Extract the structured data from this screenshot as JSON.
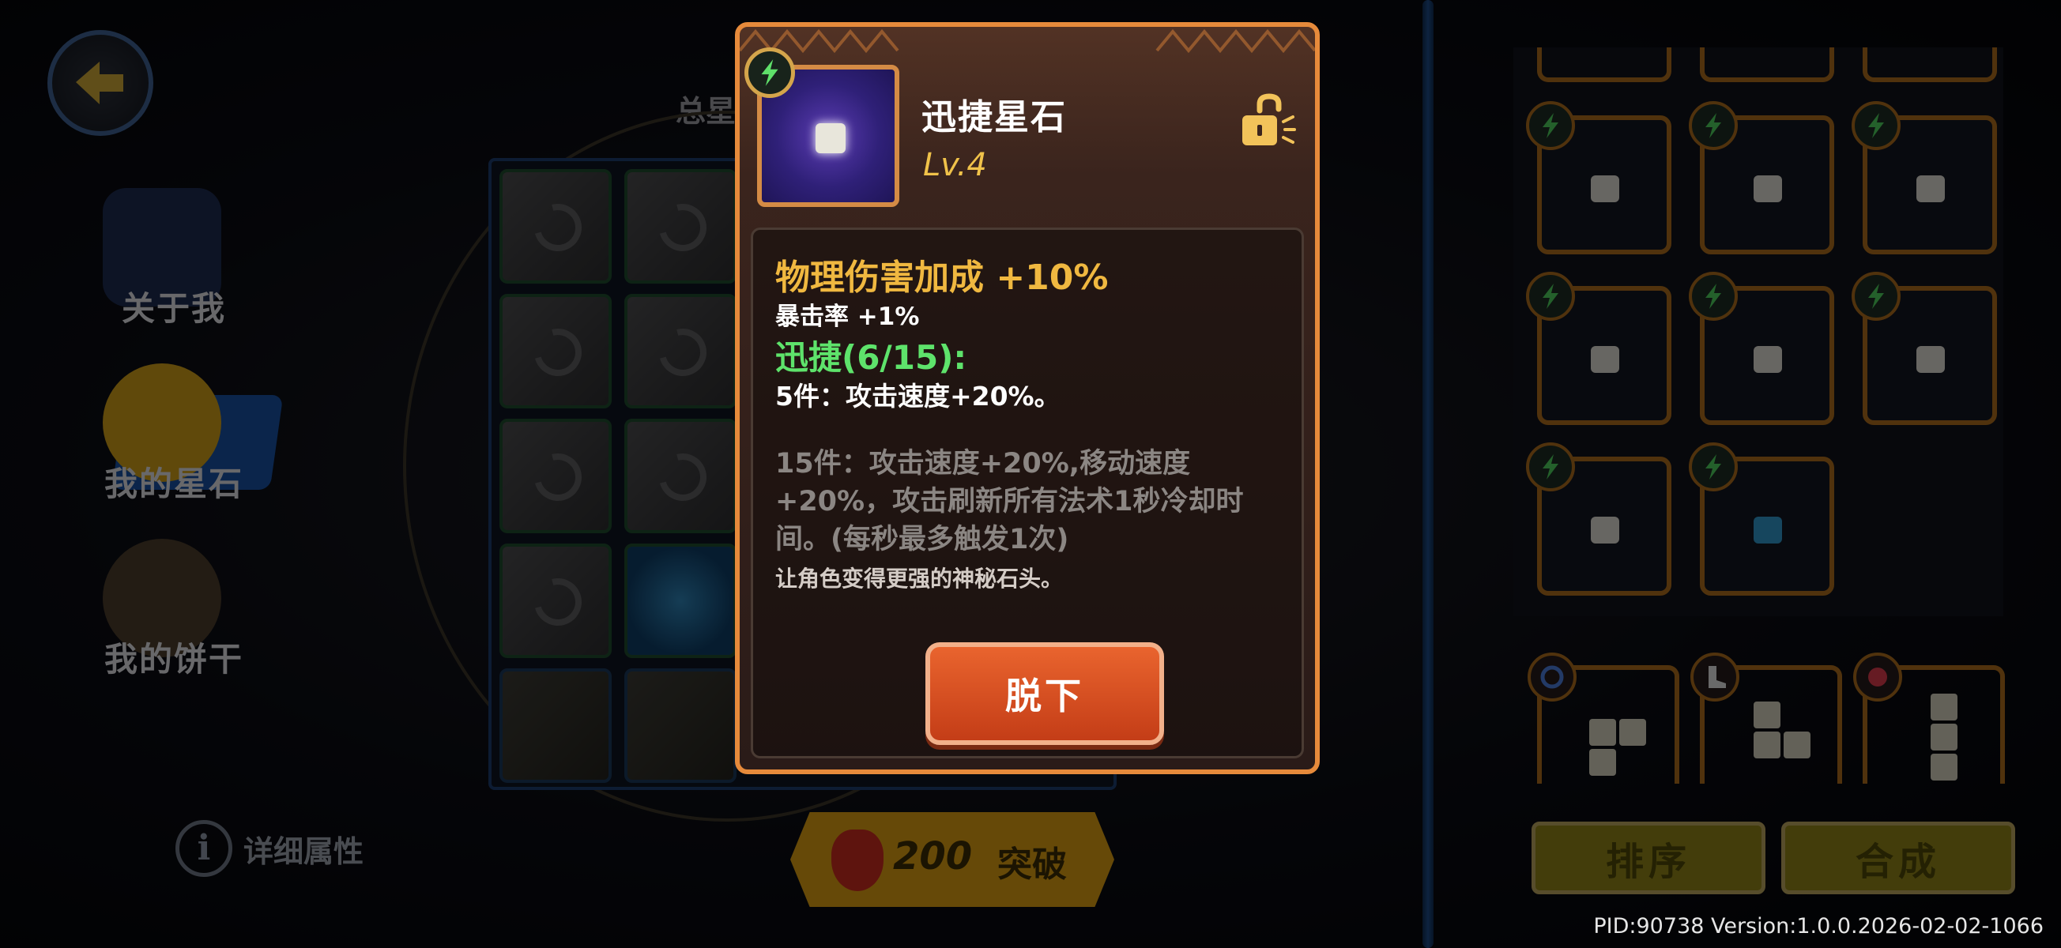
{
  "sidebar": {
    "items": [
      {
        "label": "关于我"
      },
      {
        "label": "我的星石"
      },
      {
        "label": "我的饼干"
      }
    ]
  },
  "main": {
    "total_label": "总星",
    "detail_link": "详细属性",
    "breakthrough": {
      "cost": "200",
      "label": "突破"
    }
  },
  "inventory": {
    "sort_button": "排序",
    "combine_button": "合成"
  },
  "popup": {
    "title": "迅捷星石",
    "level": "Lv.4",
    "main_stat": "物理伤害加成 +10%",
    "sub_stat": "暴击率 +1%",
    "set_title": "迅捷(6/15):",
    "set_bonus_5": "5件：攻击速度+20%。",
    "set_bonus_15": "15件：攻击速度+20%,移动速度+20%，攻击刷新所有法术1秒冷却时间。(每秒最多触发1次)",
    "flavor": "让角色变得更强的神秘石头。",
    "unequip_button": "脱下"
  },
  "footer": {
    "version": "PID:90738  Version:1.0.0.2026-02-02-1066"
  },
  "colors": {
    "popup_border": "#e68a3b",
    "main_stat": "#f0b840",
    "set_title": "#5ee36b",
    "button": "#d6501f",
    "frame": "#a76a1c"
  },
  "icons": [
    "back-arrow-icon",
    "lightning-icon",
    "unlock-icon",
    "info-icon",
    "strawberry-icon"
  ]
}
